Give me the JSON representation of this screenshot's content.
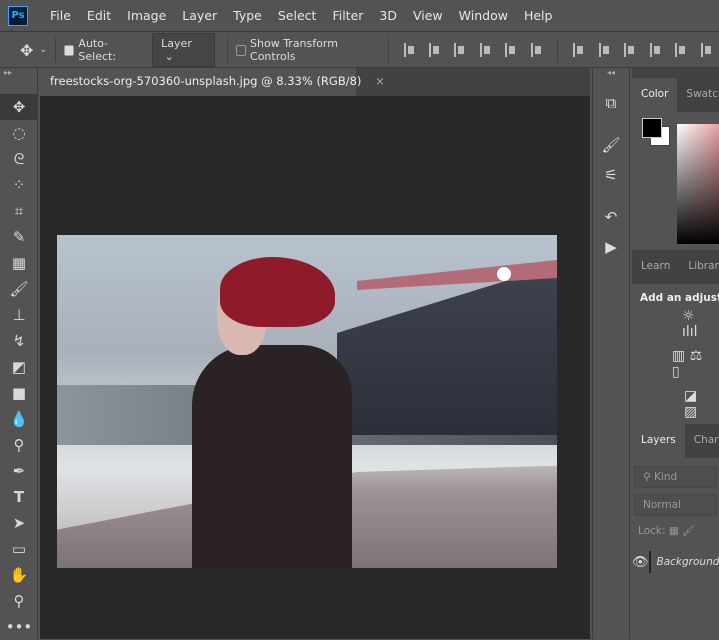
{
  "app": {
    "logo": "Ps"
  },
  "menu": [
    "File",
    "Edit",
    "Image",
    "Layer",
    "Type",
    "Select",
    "Filter",
    "3D",
    "View",
    "Window",
    "Help"
  ],
  "options": {
    "auto_select_label": "Auto-Select:",
    "auto_select_checked": true,
    "layer_select": "Layer",
    "show_transform_label": "Show Transform Controls",
    "show_transform_checked": false
  },
  "document": {
    "tab_title": "freestocks-org-570360-unsplash.jpg @ 8.33% (RGB/8)",
    "close": "×"
  },
  "tools": [
    "move",
    "marquee",
    "lasso",
    "quick-select",
    "crop",
    "eyedropper",
    "healing",
    "brush",
    "stamp",
    "history-brush",
    "eraser",
    "gradient",
    "blur",
    "dodge",
    "pen",
    "type",
    "path-select",
    "rectangle",
    "hand",
    "zoom",
    "more"
  ],
  "panels": {
    "color": {
      "tabs": [
        "Color",
        "Swatches"
      ],
      "foreground": "#000000",
      "background": "#ffffff"
    },
    "learn": {
      "tabs": [
        "Learn",
        "Libraries"
      ]
    },
    "adjustments": {
      "title": "Add an adjustment"
    },
    "layers": {
      "tabs": [
        "Layers",
        "Channels"
      ],
      "filter": "Kind",
      "blend_mode": "Normal",
      "lock_label": "Lock:",
      "layer_name": "Background"
    }
  }
}
